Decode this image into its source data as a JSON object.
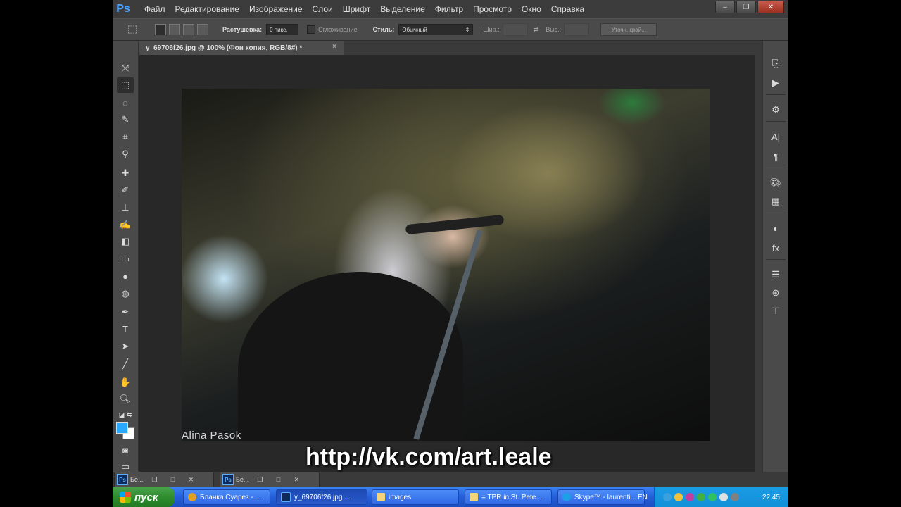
{
  "menubar": {
    "logo": "Ps",
    "items": [
      "Файл",
      "Редактирование",
      "Изображение",
      "Слои",
      "Шрифт",
      "Выделение",
      "Фильтр",
      "Просмотр",
      "Окно",
      "Справка"
    ]
  },
  "options_bar": {
    "feather_label": "Растушевка:",
    "feather_value": "0 пикс.",
    "antialias_label": "Сглаживание",
    "style_label": "Стиль:",
    "style_value": "Обычный",
    "width_label": "Шир.:",
    "height_label": "Выс.:",
    "refine_edge_label": "Уточн. край..."
  },
  "document": {
    "tab_title": "y_69706f26.jpg @ 100% (Фон копия, RGB/8#) *",
    "close_glyph": "×",
    "photo_credit": "Alina Pasok"
  },
  "overlay": {
    "url": "http://vk.com/art.leale"
  },
  "minimized_docs": [
    {
      "title": "Бе..."
    },
    {
      "title": "Бе..."
    }
  ],
  "taskbar": {
    "start_label": "пуск",
    "tasks": [
      {
        "label": "Бланка Суарез - ...",
        "icon_color": "#e0a020"
      },
      {
        "label": "y_69706f26.jpg ...",
        "icon_color": "#0e2a5a"
      },
      {
        "label": "images",
        "icon_color": "#f2d47a"
      },
      {
        "label": "= TPR in St. Pete...",
        "icon_color": "#f2d47a"
      },
      {
        "label": "Skype™ - laurenti...",
        "icon_color": "#1ea0e8"
      }
    ],
    "language": "EN",
    "clock": "22:45"
  },
  "colors": {
    "foreground": "#28a8ff",
    "background": "#ffffff",
    "ps_blue": "#4aa3ff"
  }
}
